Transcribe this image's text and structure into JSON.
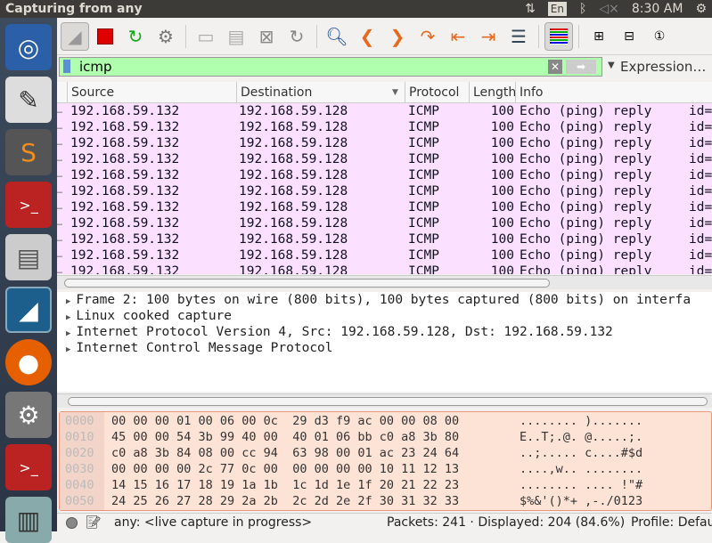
{
  "topbar": {
    "title": "Capturing from any",
    "lang": "En",
    "time": "8:30 AM"
  },
  "filter": {
    "value": "icmp",
    "expression_label": "Expression…"
  },
  "columns": [
    "Source",
    "Destination",
    "Protocol",
    "Length",
    "Info"
  ],
  "packets": [
    {
      "src": "192.168.59.132",
      "dst": "192.168.59.128",
      "proto": "ICMP",
      "len": "100",
      "info": "Echo (ping) reply",
      "extra": "id="
    },
    {
      "src": "192.168.59.132",
      "dst": "192.168.59.128",
      "proto": "ICMP",
      "len": "100",
      "info": "Echo (ping) reply",
      "extra": "id="
    },
    {
      "src": "192.168.59.132",
      "dst": "192.168.59.128",
      "proto": "ICMP",
      "len": "100",
      "info": "Echo (ping) reply",
      "extra": "id="
    },
    {
      "src": "192.168.59.132",
      "dst": "192.168.59.128",
      "proto": "ICMP",
      "len": "100",
      "info": "Echo (ping) reply",
      "extra": "id="
    },
    {
      "src": "192.168.59.132",
      "dst": "192.168.59.128",
      "proto": "ICMP",
      "len": "100",
      "info": "Echo (ping) reply",
      "extra": "id="
    },
    {
      "src": "192.168.59.132",
      "dst": "192.168.59.128",
      "proto": "ICMP",
      "len": "100",
      "info": "Echo (ping) reply",
      "extra": "id="
    },
    {
      "src": "192.168.59.132",
      "dst": "192.168.59.128",
      "proto": "ICMP",
      "len": "100",
      "info": "Echo (ping) reply",
      "extra": "id="
    },
    {
      "src": "192.168.59.132",
      "dst": "192.168.59.128",
      "proto": "ICMP",
      "len": "100",
      "info": "Echo (ping) reply",
      "extra": "id="
    },
    {
      "src": "192.168.59.132",
      "dst": "192.168.59.128",
      "proto": "ICMP",
      "len": "100",
      "info": "Echo (ping) reply",
      "extra": "id="
    },
    {
      "src": "192.168.59.132",
      "dst": "192.168.59.128",
      "proto": "ICMP",
      "len": "100",
      "info": "Echo (ping) reply",
      "extra": "id="
    },
    {
      "src": "192.168.59.132",
      "dst": "192.168.59.128",
      "proto": "ICMP",
      "len": "100",
      "info": "Echo (ping) reply",
      "extra": "id="
    }
  ],
  "details": [
    "Frame 2: 100 bytes on wire (800 bits), 100 bytes captured (800 bits) on interfa",
    "Linux cooked capture",
    "Internet Protocol Version 4, Src: 192.168.59.128, Dst: 192.168.59.132",
    "Internet Control Message Protocol"
  ],
  "hex": [
    {
      "off": "0000",
      "bytes": "00 00 00 01 00 06 00 0c  29 d3 f9 ac 00 00 08 00",
      "ascii": "........ )......."
    },
    {
      "off": "0010",
      "bytes": "45 00 00 54 3b 99 40 00  40 01 06 bb c0 a8 3b 80",
      "ascii": "E..T;.@. @.....;."
    },
    {
      "off": "0020",
      "bytes": "c0 a8 3b 84 08 00 cc 94  63 98 00 01 ac 23 24 64",
      "ascii": "..;..... c....#$d"
    },
    {
      "off": "0030",
      "bytes": "00 00 00 00 2c 77 0c 00  00 00 00 00 10 11 12 13",
      "ascii": "....,w.. ........"
    },
    {
      "off": "0040",
      "bytes": "14 15 16 17 18 19 1a 1b  1c 1d 1e 1f 20 21 22 23",
      "ascii": "........ .... !\"#"
    },
    {
      "off": "0050",
      "bytes": "24 25 26 27 28 29 2a 2b  2c 2d 2e 2f 30 31 32 33",
      "ascii": "$%&'()*+ ,-./0123"
    }
  ],
  "status": {
    "capture": "any: <live capture in progress>",
    "packets": "Packets: 241 · Displayed: 204 (84.6%)",
    "profile": "Profile: Defau"
  }
}
